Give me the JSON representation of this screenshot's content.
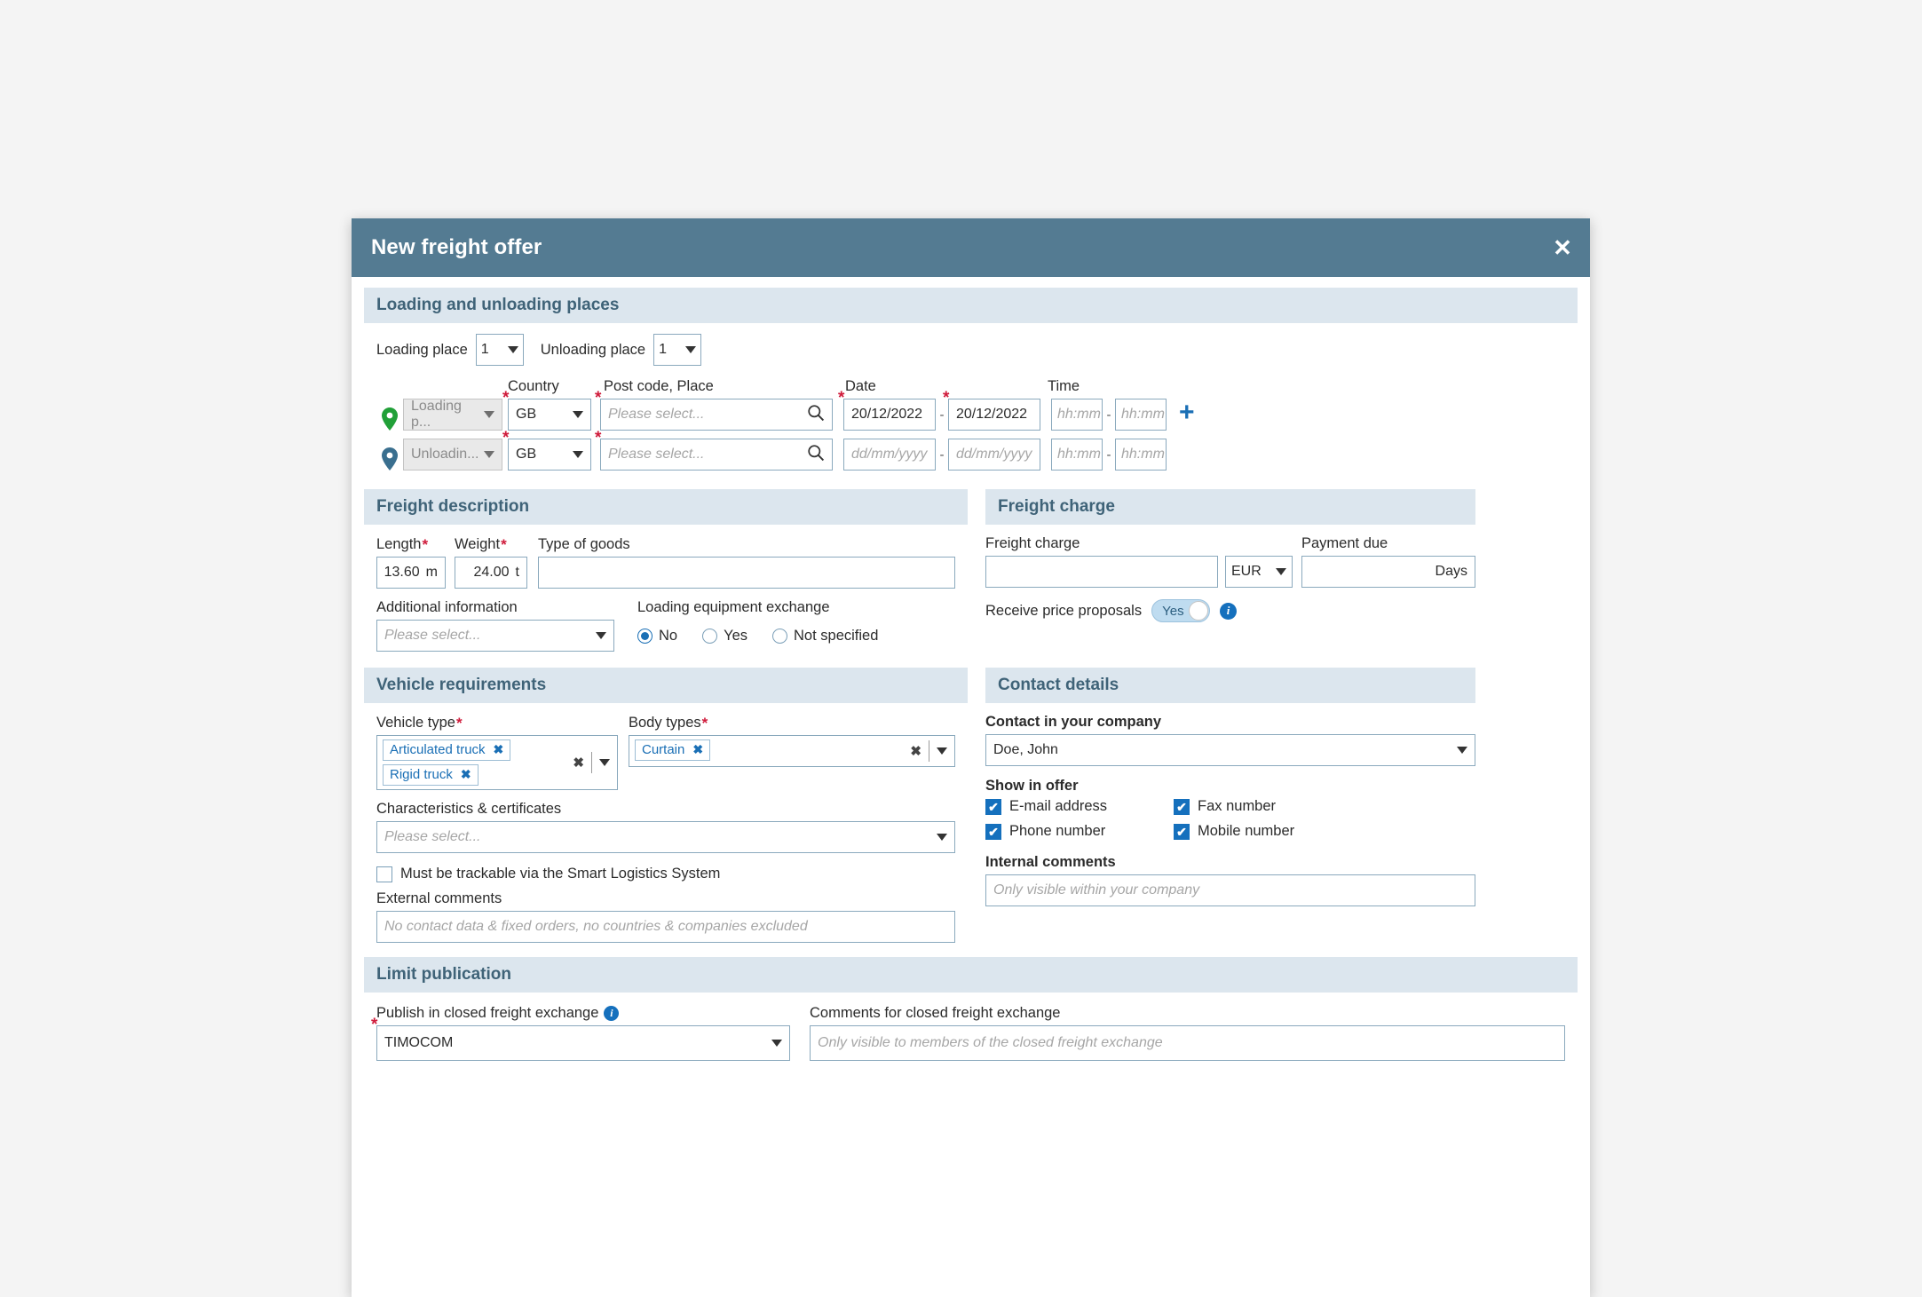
{
  "dialog": {
    "title": "New freight offer",
    "close_icon": "close-icon"
  },
  "sections": {
    "places": "Loading and unloading places",
    "freight_description": "Freight description",
    "freight_charge": "Freight charge",
    "vehicle_requirements": "Vehicle requirements",
    "contact_details": "Contact details",
    "limit_publication": "Limit publication"
  },
  "places": {
    "loading_place_label": "Loading place",
    "loading_place_count": "1",
    "unloading_place_label": "Unloading place",
    "unloading_place_count": "1",
    "col_country": "Country",
    "col_postcode": "Post code, Place",
    "col_date": "Date",
    "col_time": "Time",
    "add_row_icon": "plus-icon",
    "rows": [
      {
        "pin": "green",
        "type_value": "Loading p...",
        "country": "GB",
        "postcode_placeholder": "Please select...",
        "postcode_value": "",
        "date_from": "20/12/2022",
        "date_to": "20/12/2022",
        "date_placeholder": "dd/mm/yyyy",
        "time_from": "",
        "time_to": "",
        "time_placeholder": "hh:mm"
      },
      {
        "pin": "blue",
        "type_value": "Unloadin...",
        "country": "GB",
        "postcode_placeholder": "Please select...",
        "postcode_value": "",
        "date_from": "",
        "date_to": "",
        "date_placeholder": "dd/mm/yyyy",
        "time_from": "",
        "time_to": "",
        "time_placeholder": "hh:mm"
      }
    ]
  },
  "freight_description": {
    "length_label": "Length",
    "length_value": "13.60",
    "length_unit": "m",
    "weight_label": "Weight",
    "weight_value": "24.00",
    "weight_unit": "t",
    "type_of_goods_label": "Type of goods",
    "type_of_goods_value": "",
    "additional_info_label": "Additional information",
    "additional_info_placeholder": "Please select...",
    "loading_equipment_label": "Loading equipment exchange",
    "loading_equipment_options": [
      "No",
      "Yes",
      "Not specified"
    ],
    "loading_equipment_selected": "No"
  },
  "freight_charge": {
    "charge_label": "Freight charge",
    "charge_value": "",
    "currency_value": "EUR",
    "payment_due_label": "Payment due",
    "payment_due_value": "",
    "payment_due_unit": "Days",
    "price_proposals_label": "Receive price proposals",
    "price_proposals_toggle": "Yes",
    "info_icon": "info-icon"
  },
  "vehicle_requirements": {
    "vehicle_type_label": "Vehicle type",
    "vehicle_type_tags": [
      "Articulated truck",
      "Rigid truck"
    ],
    "body_types_label": "Body types",
    "body_types_tags": [
      "Curtain"
    ],
    "characteristics_label": "Characteristics & certificates",
    "characteristics_placeholder": "Please select...",
    "trackable_label": "Must be trackable via the Smart Logistics System",
    "trackable_checked": false,
    "external_comments_label": "External comments",
    "external_comments_placeholder": "No contact data & fixed orders, no countries & companies excluded"
  },
  "contact_details": {
    "contact_label": "Contact in your company",
    "contact_value": "Doe, John",
    "show_in_offer_label": "Show in offer",
    "checkboxes": [
      {
        "label": "E-mail address",
        "checked": true
      },
      {
        "label": "Fax number",
        "checked": true
      },
      {
        "label": "Phone number",
        "checked": true
      },
      {
        "label": "Mobile number",
        "checked": true
      }
    ],
    "internal_comments_label": "Internal comments",
    "internal_comments_placeholder": "Only visible within your company"
  },
  "limit_publication": {
    "publish_label": "Publish in closed freight exchange",
    "publish_value": "TIMOCOM",
    "info_icon": "info-icon",
    "comments_label": "Comments for closed freight exchange",
    "comments_placeholder": "Only visible to members of the closed freight exchange"
  },
  "colors": {
    "titlebar": "#547b92",
    "section_header": "#dce6ee",
    "section_header_text": "#3f6378",
    "accent_blue": "#1570bd",
    "required_red": "#cf1b3b",
    "pin_green": "#21a038",
    "pin_blue": "#3a6f8f"
  }
}
